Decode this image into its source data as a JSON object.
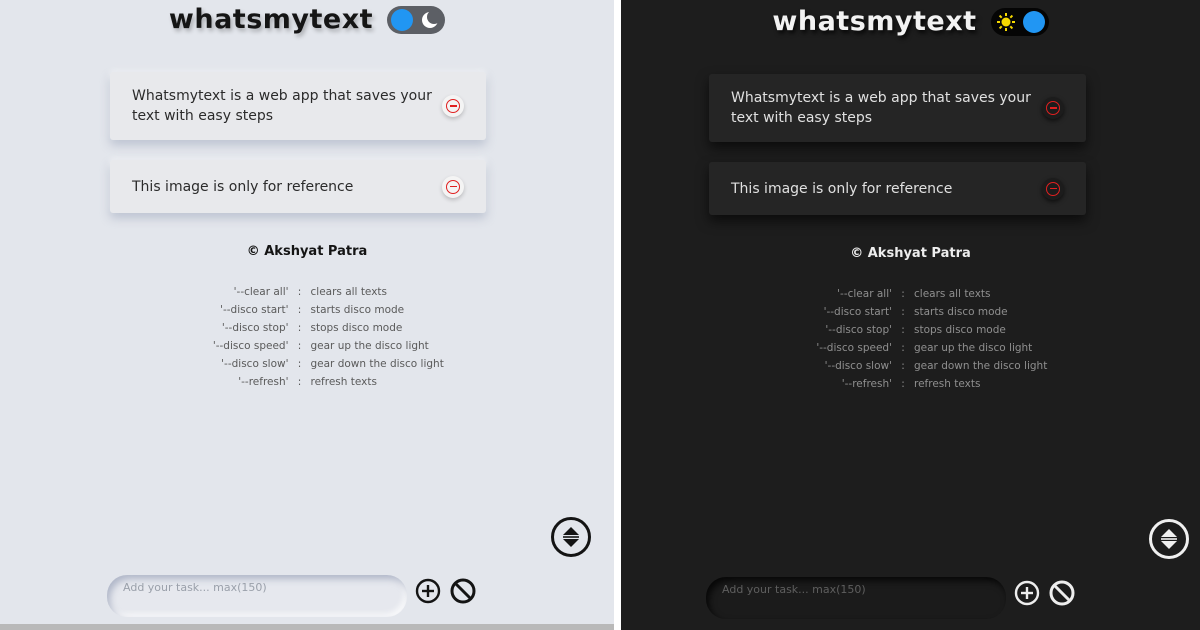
{
  "app": {
    "title": "whatsmytext"
  },
  "colors": {
    "light_bg": "#e3e6ec",
    "dark_bg": "#1d1d1d",
    "toggle_knob": "#2196f3",
    "remove_red": "#e02020",
    "sun_yellow": "#f5d800"
  },
  "icons": {
    "light_mode": "moon-icon",
    "dark_mode": "sun-icon",
    "remove": "minus-circle-icon",
    "scroll": "up-down-arrows-icon",
    "add": "plus-circle-icon",
    "clear": "ban-icon"
  },
  "notes": [
    {
      "text": "Whatsmytext is a web app that saves your text with easy steps"
    },
    {
      "text": "This image is only for reference"
    }
  ],
  "credit": "© Akshyat Patra",
  "commands": [
    {
      "key": "'--clear all'",
      "sep": ":",
      "desc": "clears all texts"
    },
    {
      "key": "'--disco start'",
      "sep": ":",
      "desc": "starts disco mode"
    },
    {
      "key": "'--disco stop'",
      "sep": ":",
      "desc": "stops disco mode"
    },
    {
      "key": "'--disco speed'",
      "sep": ":",
      "desc": "gear up the disco light"
    },
    {
      "key": "'--disco slow'",
      "sep": ":",
      "desc": "gear down the disco light"
    },
    {
      "key": "'--refresh'",
      "sep": ":",
      "desc": "refresh texts"
    }
  ],
  "input": {
    "placeholder": "Add your task... max(150)",
    "value": ""
  }
}
